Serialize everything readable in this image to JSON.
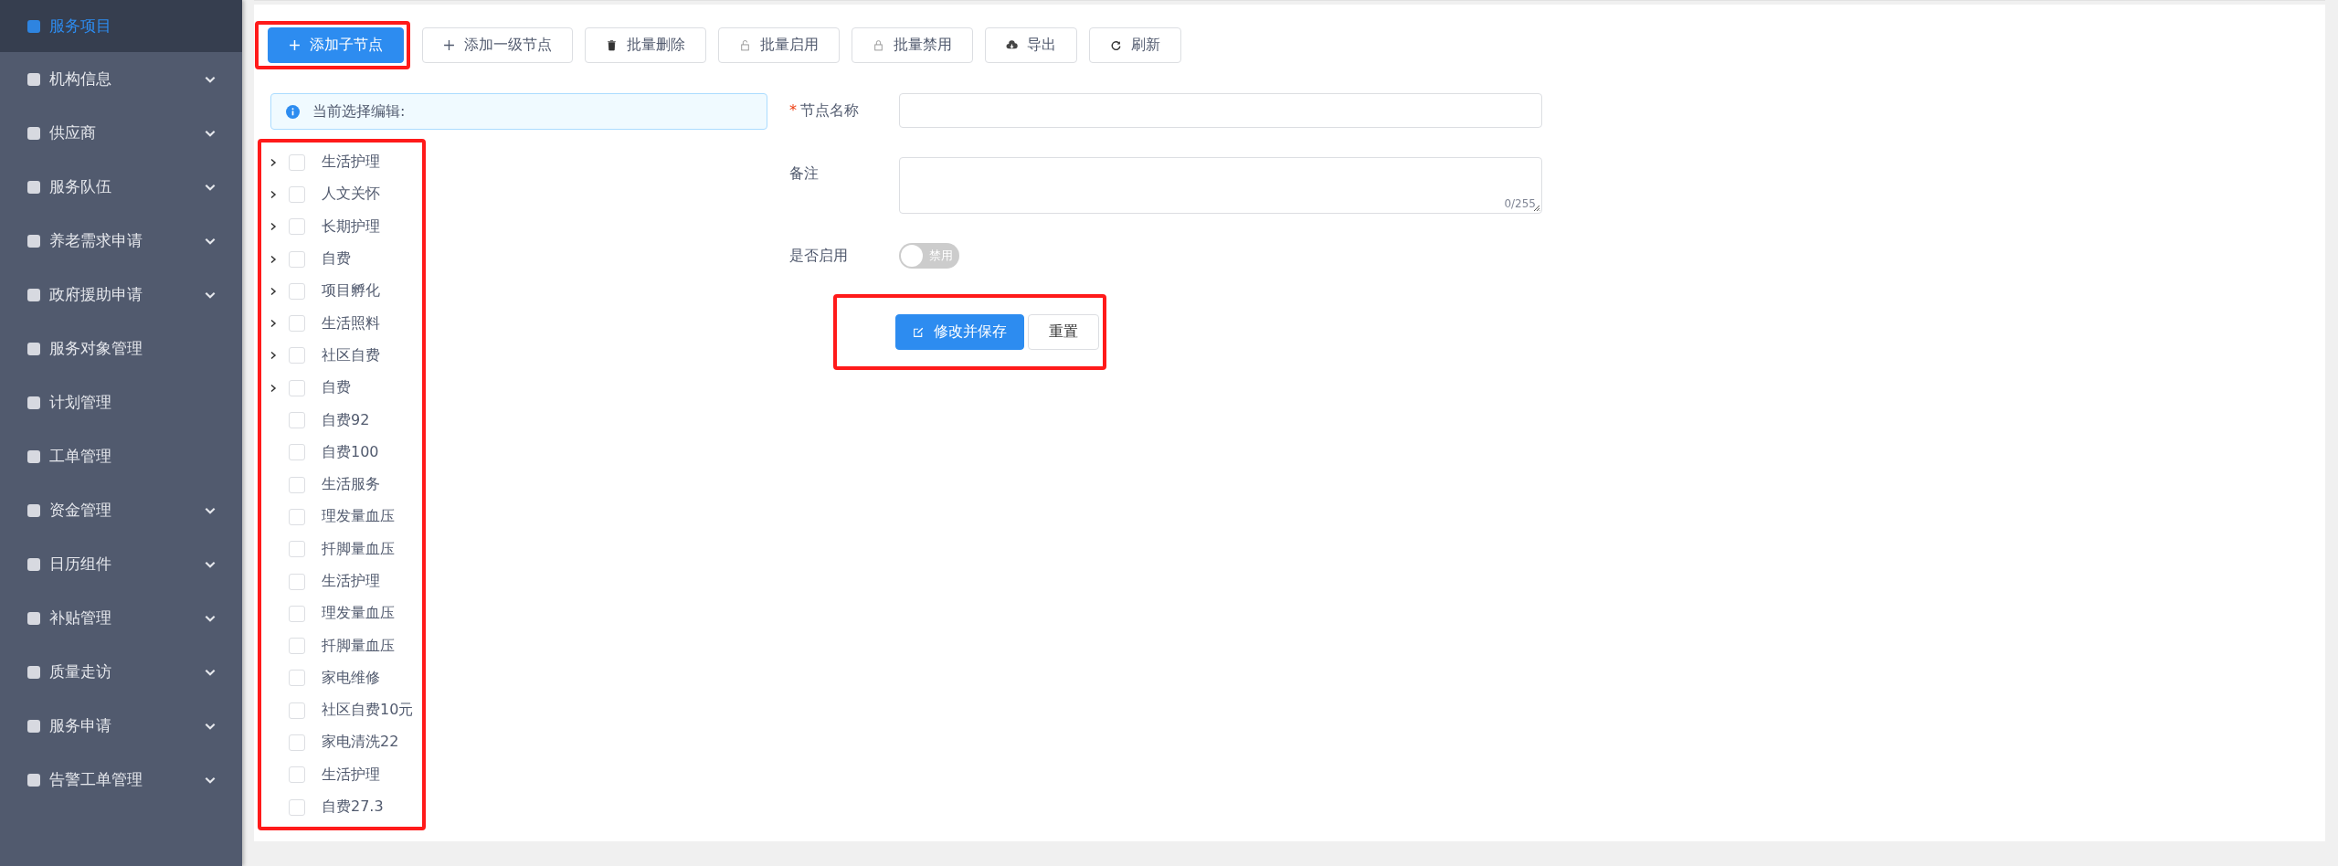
{
  "sidebar": {
    "items": [
      {
        "label": "服务项目",
        "selected": true,
        "has_submenu": false
      },
      {
        "label": "机构信息",
        "selected": false,
        "has_submenu": true
      },
      {
        "label": "供应商",
        "selected": false,
        "has_submenu": true
      },
      {
        "label": "服务队伍",
        "selected": false,
        "has_submenu": true
      },
      {
        "label": "养老需求申请",
        "selected": false,
        "has_submenu": true
      },
      {
        "label": "政府援助申请",
        "selected": false,
        "has_submenu": true
      },
      {
        "label": "服务对象管理",
        "selected": false,
        "has_submenu": false
      },
      {
        "label": "计划管理",
        "selected": false,
        "has_submenu": false
      },
      {
        "label": "工单管理",
        "selected": false,
        "has_submenu": false
      },
      {
        "label": "资金管理",
        "selected": false,
        "has_submenu": true
      },
      {
        "label": "日历组件",
        "selected": false,
        "has_submenu": true
      },
      {
        "label": "补贴管理",
        "selected": false,
        "has_submenu": true
      },
      {
        "label": "质量走访",
        "selected": false,
        "has_submenu": true
      },
      {
        "label": "服务申请",
        "selected": false,
        "has_submenu": true
      },
      {
        "label": "告警工单管理",
        "selected": false,
        "has_submenu": true
      }
    ]
  },
  "toolbar": [
    {
      "label": "添加子节点",
      "kind": "primary",
      "highlighted": true
    },
    {
      "label": "添加一级节点",
      "kind": "default",
      "highlighted": false
    },
    {
      "label": "批量删除",
      "kind": "default",
      "highlighted": false
    },
    {
      "label": "批量启用",
      "kind": "default",
      "highlighted": false
    },
    {
      "label": "批量禁用",
      "kind": "default",
      "highlighted": false
    },
    {
      "label": "导出",
      "kind": "default",
      "highlighted": false
    },
    {
      "label": "刷新",
      "kind": "default",
      "highlighted": false
    }
  ],
  "info_alert": "当前选择编辑:",
  "tree": {
    "highlighted": true,
    "nodes": [
      {
        "label": "生活护理",
        "kind": "branch",
        "expanded": false,
        "checked": false
      },
      {
        "label": "人文关怀",
        "kind": "branch",
        "expanded": false,
        "checked": false
      },
      {
        "label": "长期护理",
        "kind": "branch",
        "expanded": false,
        "checked": false
      },
      {
        "label": "自费",
        "kind": "branch",
        "expanded": false,
        "checked": false
      },
      {
        "label": "项目孵化",
        "kind": "branch",
        "expanded": false,
        "checked": false
      },
      {
        "label": "生活照料",
        "kind": "branch",
        "expanded": false,
        "checked": false
      },
      {
        "label": "社区自费",
        "kind": "branch",
        "expanded": false,
        "checked": false
      },
      {
        "label": "自费",
        "kind": "branch",
        "expanded": false,
        "checked": false
      },
      {
        "label": "自费92",
        "kind": "leaf",
        "checked": false
      },
      {
        "label": "自费100",
        "kind": "leaf",
        "checked": false
      },
      {
        "label": "生活服务",
        "kind": "leaf",
        "checked": false
      },
      {
        "label": "理发量血压",
        "kind": "leaf",
        "checked": false
      },
      {
        "label": "扦脚量血压",
        "kind": "leaf",
        "checked": false
      },
      {
        "label": "生活护理",
        "kind": "leaf",
        "checked": false
      },
      {
        "label": "理发量血压",
        "kind": "leaf",
        "checked": false
      },
      {
        "label": "扦脚量血压",
        "kind": "leaf",
        "checked": false
      },
      {
        "label": "家电维修",
        "kind": "leaf",
        "checked": false
      },
      {
        "label": "社区自费10元",
        "kind": "leaf",
        "checked": false
      },
      {
        "label": "家电清洗22",
        "kind": "leaf",
        "checked": false
      },
      {
        "label": "生活护理",
        "kind": "leaf",
        "checked": false
      },
      {
        "label": "自费27.3",
        "kind": "leaf",
        "checked": false
      }
    ]
  },
  "form": {
    "name_label": "节点名称",
    "required_mark": "*",
    "remark_label": "备注",
    "remark_counter": "0/255",
    "enabled_label": "是否启用",
    "enabled_switch": {
      "on": false,
      "text": "禁用"
    },
    "actions": {
      "highlighted": true,
      "save": "修改并保存",
      "reset": "重置"
    }
  }
}
